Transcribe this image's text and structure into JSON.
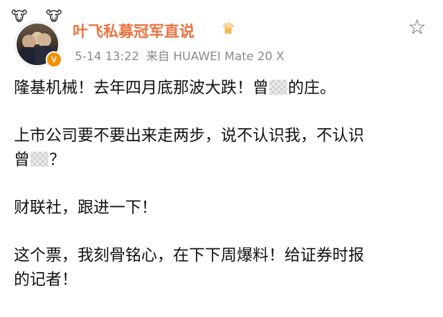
{
  "post": {
    "author": "叶飞私募冠军直说",
    "verified_badge": "V",
    "timestamp": "5-14 13:22",
    "source": "来自 HUAWEI Mate 20 X",
    "badges": [
      "ox-icon",
      "ox-icon"
    ],
    "crown_icon": "crown-icon",
    "star_icon": "star-outline-icon"
  },
  "content": {
    "p1_before": "隆基机械！去年四月底那波大跌！曾",
    "p1_after": "的庄。",
    "p2_line1": "上市公司要不要出来走两步，说不认识我，不认识",
    "p2_line2_before": "曾",
    "p2_line2_after": "？",
    "p3": "财联社，跟进一下！",
    "p4_line1": "这个票，我刻骨铭心，在下下周爆料！给证券时报",
    "p4_line2": "的记者！"
  },
  "colors": {
    "author": "#eb7340",
    "meta": "#8a8a8a",
    "text": "#111111",
    "verified": "#f29100"
  }
}
